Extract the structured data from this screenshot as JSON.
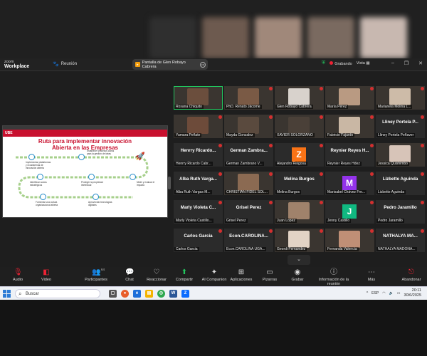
{
  "colors": {
    "accent_red": "#c8102e",
    "speaker_green": "#22c55e",
    "rec_red": "#ee2233"
  },
  "titlebar": {
    "app_line1": "zoom",
    "app_line2": "Workplace",
    "meeting_label": "Reunión",
    "share_tab_label": "Pantalla de Glen Robayo Cabrera",
    "recording_label": "Grabando",
    "view_label": "Vista",
    "icons": [
      "shield-icon",
      "minimize-icon",
      "maximize-icon",
      "close-icon"
    ]
  },
  "slide": {
    "brand": "UBE",
    "title_line1": "Ruta para implementar innovación",
    "title_line2": "Abierta en las Empresas",
    "steps": [
      "Implementar plataformas y ecosistemas de innovación abierta",
      "Establecer procesos claros para la gestión de ideas",
      "Identificar socios estratégicos",
      "Proteger la propiedad intelectual",
      "Medir y evaluar el impacto",
      "Fomentar una cultura organizacional abierta",
      "Aprovechar tecnologías digitales"
    ]
  },
  "participants": [
    {
      "tag": "Roxana Chiquito",
      "kind": "photo",
      "color": "#6b4e3d",
      "speaker": true,
      "muted": false
    },
    {
      "tag": "PhD. Renato Jácome",
      "kind": "photo",
      "color": "#7a5a45",
      "muted": true
    },
    {
      "tag": "Glen Robayo Cabrera",
      "kind": "photo",
      "color": "#d8d2cc",
      "muted": true
    },
    {
      "tag": "María Pérez",
      "kind": "photo",
      "color": "#b99a82",
      "muted": true
    },
    {
      "tag": "Marianela Molina L...",
      "kind": "photo",
      "color": "#cdbba8",
      "muted": true
    },
    {
      "tag": "Yamara Peñate",
      "kind": "photo",
      "color": "#6d4b3a",
      "muted": true
    },
    {
      "tag": "Mayda Gonzalez",
      "kind": "photo",
      "color": "#5a4a3e",
      "muted": true
    },
    {
      "tag": "XAVIER SOLÓRZANO",
      "kind": "photo",
      "color": "#4a4038",
      "muted": true
    },
    {
      "tag": "Fabricio Fajardo",
      "kind": "photo",
      "color": "#c9b7a4",
      "muted": true
    },
    {
      "tag": "Lliney Portela Peñaver",
      "kind": "name",
      "big": "Lliney Portela P...",
      "muted": true
    },
    {
      "tag": "Henrry Ricardo Cabr...",
      "kind": "name",
      "big": "Henrry Ricardo...",
      "muted": true
    },
    {
      "tag": "German Zambrano V...",
      "kind": "name",
      "big": "German Zambra...",
      "muted": true
    },
    {
      "tag": "Alejandro Reigosa",
      "kind": "letter",
      "letter": "Z",
      "color": "#f97316",
      "muted": true
    },
    {
      "tag": "Reynier Reyes Hdez",
      "kind": "name",
      "big": "Reynier Reyes H...",
      "muted": true
    },
    {
      "tag": "Jessica Quishimbo",
      "kind": "photo",
      "color": "#d7c4b8",
      "muted": true
    },
    {
      "tag": "Alba Ruth Vargas M...",
      "kind": "name",
      "big": "Alba Ruth Varga...",
      "muted": true
    },
    {
      "tag": "CHRISTIAN FIDEL SOL...",
      "kind": "photo",
      "color": "#8b6a52",
      "muted": true
    },
    {
      "tag": "Melina Burgos",
      "kind": "name",
      "big": "Melina Burgos",
      "muted": true
    },
    {
      "tag": "Marisabel Chávez Fre...",
      "kind": "letter",
      "letter": "M",
      "color": "#9333ea",
      "muted": true
    },
    {
      "tag": "Lizbette Aguinda",
      "kind": "name",
      "big": "Lizbette Aguinda",
      "muted": true
    },
    {
      "tag": "Marly Violeta Castillo...",
      "kind": "name",
      "big": "Marly Violeta C...",
      "muted": true
    },
    {
      "tag": "Grisel Perez",
      "kind": "name",
      "big": "Grisel Perez",
      "muted": true
    },
    {
      "tag": "Juan Lopez",
      "kind": "photo",
      "color": "#a0826b",
      "muted": true
    },
    {
      "tag": "Jenny Castillo",
      "kind": "letter",
      "letter": "J",
      "color": "#10b981",
      "muted": true
    },
    {
      "tag": "Pedro Jaramillo",
      "kind": "name",
      "big": "Pedro Jaramillo",
      "muted": true
    },
    {
      "tag": "Carlos Garcia",
      "kind": "name",
      "big": "Carlos Garcia",
      "muted": true
    },
    {
      "tag": "Econ.CAROLINA UGA...",
      "kind": "name",
      "big": "Econ.CAROLINA...",
      "muted": true
    },
    {
      "tag": "Geordi Fernandez",
      "kind": "photo",
      "color": "#e2d3c5",
      "muted": true
    },
    {
      "tag": "Fernanda Valencia",
      "kind": "photo",
      "color": "#c08f76",
      "muted": true
    },
    {
      "tag": "NATHALYA MADONA...",
      "kind": "name",
      "big": "NATHALYA MA...",
      "muted": true
    }
  ],
  "toolbar": {
    "audio": "Audio",
    "video": "Video",
    "participants": "Participantes",
    "participants_count": "64",
    "chat": "Chat",
    "react": "Reaccionar",
    "share": "Compartir",
    "ai": "AI Companion",
    "apps": "Aplicaciones",
    "whiteboards": "Pizarras",
    "record": "Grabar",
    "info": "Información de la reunión",
    "more": "Más",
    "leave": "Abandonar"
  },
  "taskbar": {
    "search_placeholder": "Buscar",
    "language": "ESP",
    "time": "20:11",
    "date": "30/6/2025",
    "apps": [
      "task-view-icon",
      "edge-icon",
      "file-explorer-icon",
      "chrome-icon",
      "word-icon",
      "zoom-app-icon"
    ]
  }
}
